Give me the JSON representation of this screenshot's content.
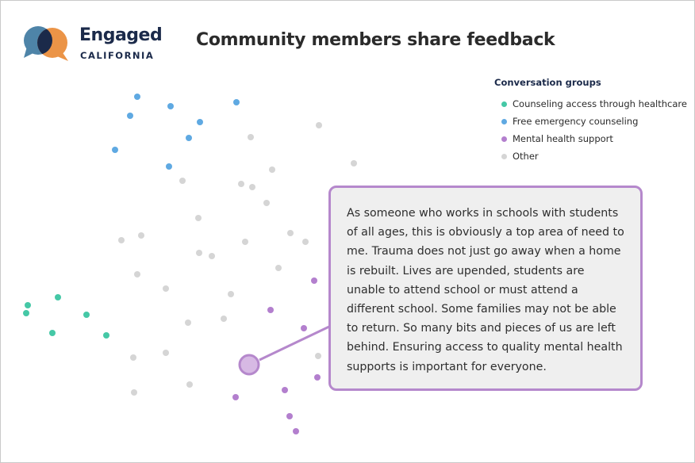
{
  "brand": {
    "name": "Engaged",
    "subtitle": "CALIFORNIA",
    "colors": {
      "bubble_blue": "#4e84a8",
      "bubble_orange": "#eb9447",
      "overlap": "#1b2a4a",
      "text": "#1b2a4a"
    }
  },
  "header": {
    "title": "Community members share feedback"
  },
  "legend": {
    "title": "Conversation groups",
    "items": [
      {
        "label": "Counseling access through healthcare",
        "color": "#45c8a6"
      },
      {
        "label": "Free emergency counseling",
        "color": "#5fa9e2"
      },
      {
        "label": "Mental health support",
        "color": "#b37fce"
      },
      {
        "label": "Other",
        "color": "#d5d5d5"
      }
    ]
  },
  "callout": {
    "text": "As someone who works in schools with students of all ages, this is obviously a top area of need to me. Trauma does not just go away when a home is rebuilt. Lives are upended, students are unable to attend school or must attend a different school. Some families may not be able to return. So many bits and pieces of us are left behind. Ensuring access to quality mental health supports is important for everyone.",
    "border_color": "#b588cc",
    "background": "#efefef"
  }
}
